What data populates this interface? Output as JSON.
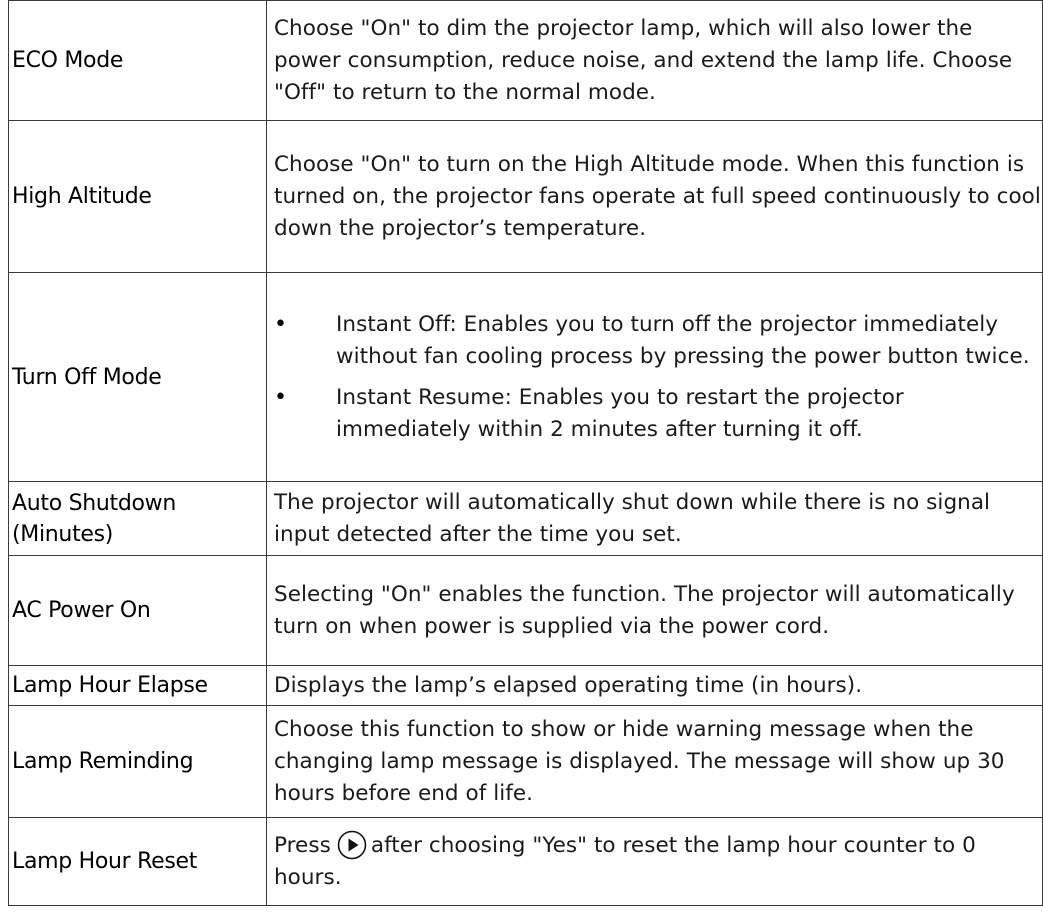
{
  "rows": [
    {
      "label": "ECO Mode",
      "description": "Choose \"On\" to dim the projector lamp, which will also lower the power consumption, reduce noise, and extend the lamp life. Choose \"Off\" to return to the normal mode."
    },
    {
      "label": "High Altitude",
      "description": "Choose \"On\" to turn on the High Altitude mode. When this function is turned on, the projector fans operate at full speed continuously to cool down the projector’s temperature."
    },
    {
      "label": "Turn Off Mode",
      "bullets": [
        "Instant Off: Enables you to turn off the projector immediately without fan cooling process by pressing the power button twice.",
        "Instant Resume: Enables you to restart the projector immediately within 2 minutes after turning it off."
      ]
    },
    {
      "label": "Auto Shutdown (Minutes)",
      "description": "The projector will automatically shut down while there is no signal input detected after the time you set."
    },
    {
      "label": "AC Power On",
      "description": "Selecting \"On\" enables the function. The projector will automatically turn on when power is supplied via the power cord."
    },
    {
      "label": "Lamp Hour Elapse",
      "description": "Displays the lamp’s elapsed operating time (in hours)."
    },
    {
      "label": "Lamp Reminding",
      "description": "Choose this function to show or hide warning message when the changing lamp message is displayed. The message will show up 30 hours before end of life."
    },
    {
      "label": "Lamp Hour Reset",
      "description_before": "Press",
      "description_after": "after choosing \"Yes\" to reset the lamp hour counter to 0 hours.",
      "icon": "right-button-icon"
    }
  ]
}
